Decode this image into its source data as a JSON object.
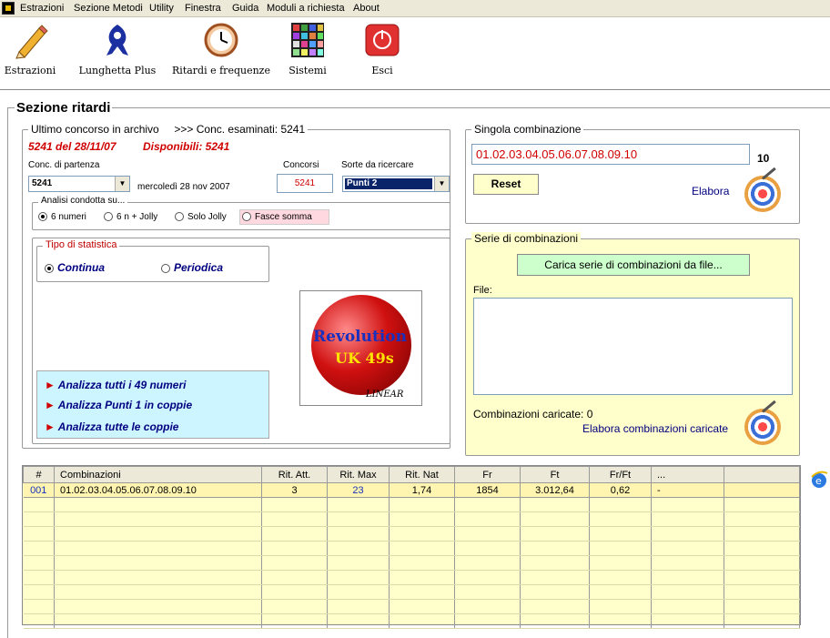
{
  "menubar": {
    "items": [
      "Estrazioni",
      "Sezione Metodi",
      "Utility",
      "Finestra",
      "Guida",
      "Moduli a richiesta",
      "About"
    ]
  },
  "toolbar": {
    "buttons": [
      {
        "label": "Estrazioni",
        "icon": "pencil-icon"
      },
      {
        "label": "Lunghetta Plus",
        "icon": "lottery-logo-icon"
      },
      {
        "label": "Ritardi e frequenze",
        "icon": "clock-icon"
      },
      {
        "label": "Sistemi",
        "icon": "grid-icon"
      },
      {
        "label": "Esci",
        "icon": "power-icon"
      }
    ]
  },
  "section_title": "Sezione ritardi",
  "archive": {
    "title": "Ultimo concorso in archivo",
    "examined": ">>> Conc. esaminati: 5241",
    "last": "5241  del 28/11/07",
    "available": "Disponibili: 5241",
    "start_label": "Conc. di partenza",
    "start_value": "5241",
    "start_date": "mercoledì 28 nov 2007",
    "concorsi_label": "Concorsi",
    "concorsi_value": "5241",
    "sorte_label": "Sorte da ricercare",
    "sorte_value": "Punti 2"
  },
  "analysis": {
    "title": "Analisi condotta su...",
    "options": [
      "6 numeri",
      "6 n + Jolly",
      "Solo Jolly",
      "Fasce somma"
    ],
    "selected": "6 numeri"
  },
  "stat_type": {
    "title": "Tipo di statistica",
    "options": [
      "Continua",
      "Periodica"
    ],
    "selected": "Continua"
  },
  "analyze_links": [
    "Analizza tutti i 49 numeri",
    "Analizza Punti 1 in coppie",
    "Analizza tutte le coppie"
  ],
  "logo": {
    "line1": "Revolution",
    "line2": "UK 49s",
    "line3": "LINEAR"
  },
  "single": {
    "title": "Singola combinazione",
    "combination": "01.02.03.04.05.06.07.08.09.10",
    "count": "10",
    "reset_label": "Reset",
    "elabora_label": "Elabora"
  },
  "series": {
    "title": "Serie di combinazioni",
    "load_button": "Carica serie di combinazioni da file...",
    "file_label": "File:",
    "loaded_label": "Combinazioni caricate: 0",
    "elabora_label": "Elabora combinazioni caricate"
  },
  "grid": {
    "columns": [
      "#",
      "Combinazioni",
      "Rit. Att.",
      "Rit. Max",
      "Rit. Nat",
      "Fr",
      "Ft",
      "Fr/Ft",
      "..."
    ],
    "rows": [
      [
        "001",
        "01.02.03.04.05.06.07.08.09.10",
        "3",
        "23",
        "1,74",
        "1854",
        "3.012,64",
        "0,62",
        "-"
      ]
    ]
  },
  "colors": {
    "accent_red": "#d00000",
    "panel_yellow": "#ffffcc",
    "link_blue": "#000080"
  }
}
